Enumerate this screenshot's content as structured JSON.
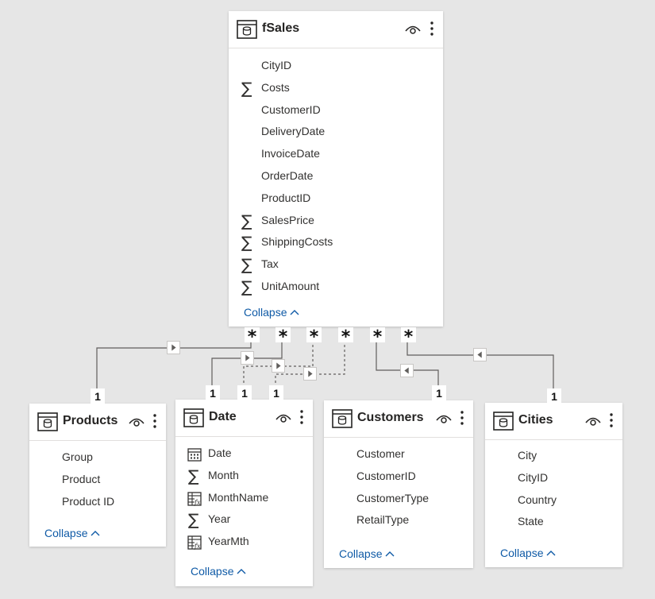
{
  "tables": {
    "fSales": {
      "title": "fSales",
      "fields": [
        "CityID",
        "Costs",
        "CustomerID",
        "DeliveryDate",
        "InvoiceDate",
        "OrderDate",
        "ProductID",
        "SalesPrice",
        "ShippingCosts",
        "Tax",
        "UnitAmount"
      ],
      "field_icons": [
        "none",
        "sigma",
        "none",
        "none",
        "none",
        "none",
        "none",
        "sigma",
        "sigma",
        "sigma",
        "sigma"
      ],
      "collapse_label": "Collapse"
    },
    "products": {
      "title": "Products",
      "fields": [
        "Group",
        "Product",
        "Product ID"
      ],
      "field_icons": [
        "none",
        "none",
        "none"
      ],
      "collapse_label": "Collapse"
    },
    "date": {
      "title": "Date",
      "fields": [
        "Date",
        "Month",
        "MonthName",
        "Year",
        "YearMth"
      ],
      "field_icons": [
        "calendar",
        "sigma",
        "calc",
        "sigma",
        "calc"
      ],
      "collapse_label": "Collapse"
    },
    "customers": {
      "title": "Customers",
      "fields": [
        "Customer",
        "CustomerID",
        "CustomerType",
        "RetailType"
      ],
      "field_icons": [
        "none",
        "none",
        "none",
        "none"
      ],
      "collapse_label": "Collapse"
    },
    "cities": {
      "title": "Cities",
      "fields": [
        "City",
        "CityID",
        "Country",
        "State"
      ],
      "field_icons": [
        "none",
        "none",
        "none",
        "none"
      ],
      "collapse_label": "Collapse"
    }
  },
  "relationships": {
    "many_symbol": "*",
    "one_symbol": "1"
  },
  "colors": {
    "background": "#e6e6e6",
    "card": "#ffffff",
    "link": "#0f5aa6",
    "line": "#605e5c"
  }
}
